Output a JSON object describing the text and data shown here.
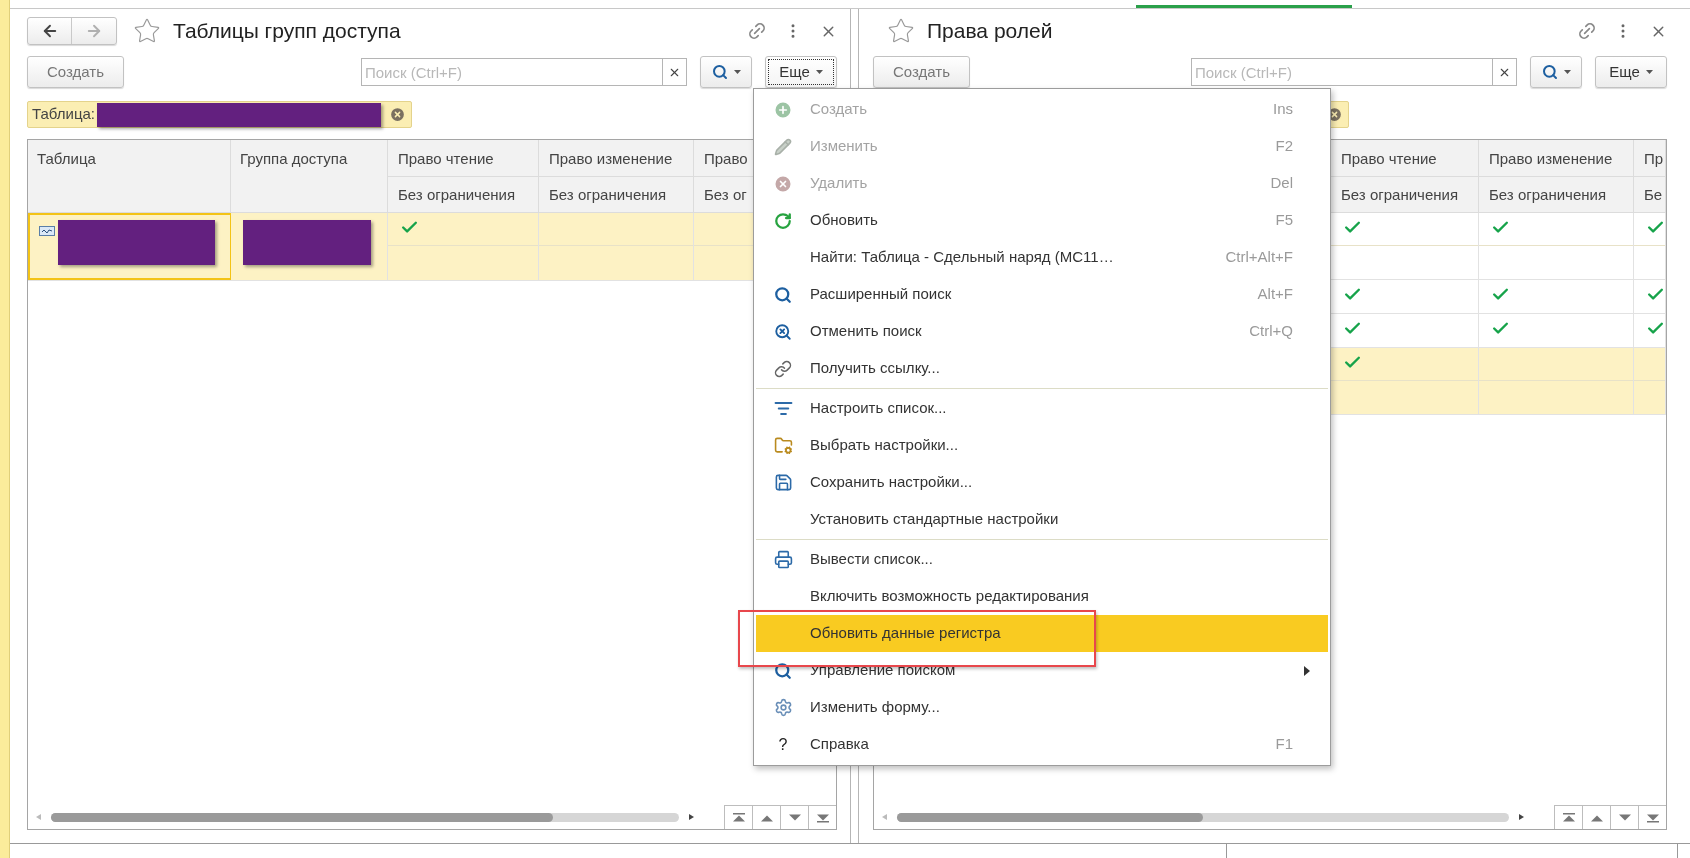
{
  "left_panel": {
    "nav": {
      "back": {
        "disabled": false
      },
      "forward": {
        "disabled": true
      }
    },
    "title": "Таблицы групп доступа",
    "create_button": "Создать",
    "search": {
      "placeholder": "Поиск (Ctrl+F)"
    },
    "more_button": {
      "label": "Еще",
      "active": true
    },
    "filter": {
      "label": "Таблица:",
      "clearable": true
    },
    "table": {
      "columns": [
        {
          "label": "Таблица"
        },
        {
          "label": "Группа доступа"
        },
        {
          "label": "Право чтение",
          "sublabel": "Без ограничения"
        },
        {
          "label": "Право изменение",
          "sublabel": "Без ограничения"
        },
        {
          "label": "Право",
          "sublabel": "Без ог"
        }
      ],
      "rows": [
        {
          "selected": true,
          "cells": [
            {
              "kind": "redacted"
            },
            {
              "kind": "redacted"
            },
            {
              "kind": "check",
              "checked": true
            },
            {
              "kind": "check",
              "checked": false
            },
            {
              "kind": "check",
              "checked": false
            }
          ]
        }
      ]
    }
  },
  "right_panel": {
    "title": "Права ролей",
    "create_button": "Создать",
    "search": {
      "placeholder": "Поиск (Ctrl+F)"
    },
    "more_button": {
      "label": "Еще",
      "active": false
    },
    "filter": {
      "clearable": true
    },
    "table": {
      "columns": [
        {
          "label": "Право чтение",
          "sublabel": "Без ограничения"
        },
        {
          "label": "Право изменение",
          "sublabel": "Без ограничения"
        },
        {
          "label": "Пр",
          "sublabel": "Бе"
        }
      ],
      "rows": [
        {
          "selected": false,
          "cells": [
            {
              "kind": "check",
              "checked": true
            },
            {
              "kind": "check",
              "checked": true
            },
            {
              "kind": "check",
              "checked": true
            }
          ]
        },
        {
          "selected": false,
          "cells": [
            {
              "kind": "check",
              "checked": true
            },
            {
              "kind": "check",
              "checked": true
            },
            {
              "kind": "check",
              "checked": true
            }
          ]
        },
        {
          "selected": false,
          "cells": [
            {
              "kind": "check",
              "checked": true
            },
            {
              "kind": "check",
              "checked": true
            },
            {
              "kind": "check",
              "checked": true
            }
          ]
        },
        {
          "selected": true,
          "cells": [
            {
              "kind": "check",
              "checked": true
            },
            {
              "kind": "check",
              "checked": false
            },
            {
              "kind": "check",
              "checked": false
            }
          ]
        }
      ]
    }
  },
  "menu": {
    "groups": [
      {
        "items": [
          {
            "label": "Создать",
            "shortcut": "Ins",
            "disabled": true,
            "selected": false,
            "submenu": false
          },
          {
            "label": "Изменить",
            "shortcut": "F2",
            "disabled": true,
            "selected": false,
            "submenu": false
          },
          {
            "label": "Удалить",
            "shortcut": "Del",
            "disabled": true,
            "selected": false,
            "submenu": false
          },
          {
            "label": "Обновить",
            "shortcut": "F5",
            "disabled": false,
            "selected": false,
            "submenu": false
          },
          {
            "label": "Найти: Таблица - Сдельный наряд (МС11…",
            "shortcut": "Ctrl+Alt+F",
            "disabled": false,
            "selected": false,
            "submenu": false
          },
          {
            "label": "Расширенный поиск",
            "shortcut": "Alt+F",
            "disabled": false,
            "selected": false,
            "submenu": false
          },
          {
            "label": "Отменить поиск",
            "shortcut": "Ctrl+Q",
            "disabled": false,
            "selected": false,
            "submenu": false
          },
          {
            "label": "Получить ссылку...",
            "disabled": false,
            "selected": false,
            "submenu": false
          }
        ]
      },
      {
        "items": [
          {
            "label": "Настроить список...",
            "disabled": false,
            "selected": false,
            "submenu": false
          },
          {
            "label": "Выбрать настройки...",
            "disabled": false,
            "selected": false,
            "submenu": false
          },
          {
            "label": "Сохранить настройки...",
            "disabled": false,
            "selected": false,
            "submenu": false
          },
          {
            "label": "Установить стандартные настройки",
            "disabled": false,
            "selected": false,
            "submenu": false
          }
        ]
      },
      {
        "items": [
          {
            "label": "Вывести список...",
            "disabled": false,
            "selected": false,
            "submenu": false
          },
          {
            "label": "Включить возможность редактирования",
            "disabled": false,
            "selected": false,
            "submenu": false
          },
          {
            "label": "Обновить данные регистра",
            "disabled": false,
            "selected": true,
            "submenu": false
          },
          {
            "label": "Управление поиском",
            "disabled": false,
            "selected": false,
            "submenu": true
          },
          {
            "label": "Изменить форму...",
            "disabled": false,
            "selected": false,
            "submenu": false
          },
          {
            "label": "Справка",
            "glyph": "?",
            "shortcut": "F1",
            "disabled": false,
            "selected": false,
            "submenu": false
          }
        ]
      }
    ]
  }
}
